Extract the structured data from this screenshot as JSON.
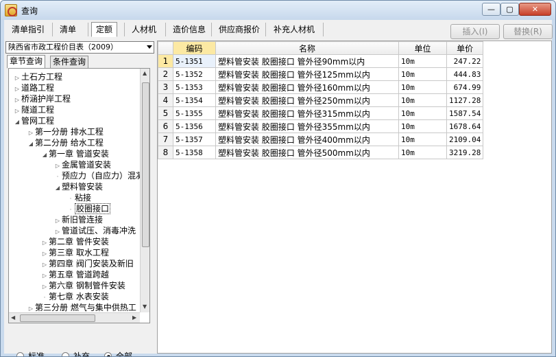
{
  "window": {
    "title": "查询",
    "min_glyph": "—",
    "max_glyph": "▢",
    "close_glyph": "✕"
  },
  "toolbar": {
    "tabs": [
      "清单指引",
      "清单",
      "定额",
      "人材机",
      "造价信息",
      "供应商报价",
      "补充人材机"
    ],
    "active_tab": "定额",
    "insert_label": "插入(I)",
    "replace_label": "替换(R)"
  },
  "left": {
    "library": "陕西省市政工程价目表（2009）",
    "subtabs": [
      "章节查询",
      "条件查询"
    ],
    "active_subtab": "章节查询",
    "tree": [
      {
        "label": "土石方工程",
        "state": "collapsed",
        "level": 0
      },
      {
        "label": "道路工程",
        "state": "collapsed",
        "level": 0
      },
      {
        "label": "桥涵护岸工程",
        "state": "collapsed",
        "level": 0
      },
      {
        "label": "隧道工程",
        "state": "collapsed",
        "level": 0
      },
      {
        "label": "管网工程",
        "state": "expanded",
        "level": 0
      },
      {
        "label": "第一分册  排水工程",
        "state": "collapsed",
        "level": 1
      },
      {
        "label": "第二分册  给水工程",
        "state": "expanded",
        "level": 1
      },
      {
        "label": "第一章  管道安装",
        "state": "expanded",
        "level": 2
      },
      {
        "label": "金属管道安装",
        "state": "collapsed",
        "level": 3
      },
      {
        "label": "预应力（自应力）混凝",
        "state": "leaf",
        "level": 3
      },
      {
        "label": "塑料管安装",
        "state": "expanded",
        "level": 3
      },
      {
        "label": "粘接",
        "state": "leaf",
        "level": 4
      },
      {
        "label": "胶圈接口",
        "state": "leaf",
        "level": 4
      },
      {
        "label": "新旧管连接",
        "state": "collapsed",
        "level": 3
      },
      {
        "label": "管道试压、消毒冲洗",
        "state": "collapsed",
        "level": 3
      },
      {
        "label": "第二章  管件安装",
        "state": "collapsed",
        "level": 2
      },
      {
        "label": "第三章  取水工程",
        "state": "collapsed",
        "level": 2
      },
      {
        "label": "第四章  阀门安装及新旧",
        "state": "collapsed",
        "level": 2
      },
      {
        "label": "第五章  管道跨越",
        "state": "collapsed",
        "level": 2
      },
      {
        "label": "第六章  钢制管件安装",
        "state": "collapsed",
        "level": 2
      },
      {
        "label": "第七章  水表安装",
        "state": "leaf",
        "level": 2
      },
      {
        "label": "第三分册  燃气与集中供热工",
        "state": "collapsed",
        "level": 1
      }
    ],
    "selected_tree_item": "胶圈接口",
    "filters": [
      "标准",
      "补充",
      "全部"
    ],
    "selected_filter": "全部"
  },
  "grid": {
    "headers": [
      "编码",
      "名称",
      "单位",
      "单价"
    ],
    "sorted_header": "编码",
    "rows": [
      {
        "n": "1",
        "code": "5-1351",
        "name": "塑料管安装  胶圈接口  管外径90mm以内",
        "unit": "10m",
        "price": "247.22"
      },
      {
        "n": "2",
        "code": "5-1352",
        "name": "塑料管安装  胶圈接口  管外径125mm以内",
        "unit": "10m",
        "price": "444.83"
      },
      {
        "n": "3",
        "code": "5-1353",
        "name": "塑料管安装  胶圈接口  管外径160mm以内",
        "unit": "10m",
        "price": "674.99"
      },
      {
        "n": "4",
        "code": "5-1354",
        "name": "塑料管安装  胶圈接口  管外径250mm以内",
        "unit": "10m",
        "price": "1127.28"
      },
      {
        "n": "5",
        "code": "5-1355",
        "name": "塑料管安装  胶圈接口  管外径315mm以内",
        "unit": "10m",
        "price": "1587.54"
      },
      {
        "n": "6",
        "code": "5-1356",
        "name": "塑料管安装  胶圈接口  管外径355mm以内",
        "unit": "10m",
        "price": "1678.64"
      },
      {
        "n": "7",
        "code": "5-1357",
        "name": "塑料管安装  胶圈接口  管外径400mm以内",
        "unit": "10m",
        "price": "2109.04"
      },
      {
        "n": "8",
        "code": "5-1358",
        "name": "塑料管安装  胶圈接口  管外径500mm以内",
        "unit": "10m",
        "price": "3219.28"
      }
    ]
  }
}
